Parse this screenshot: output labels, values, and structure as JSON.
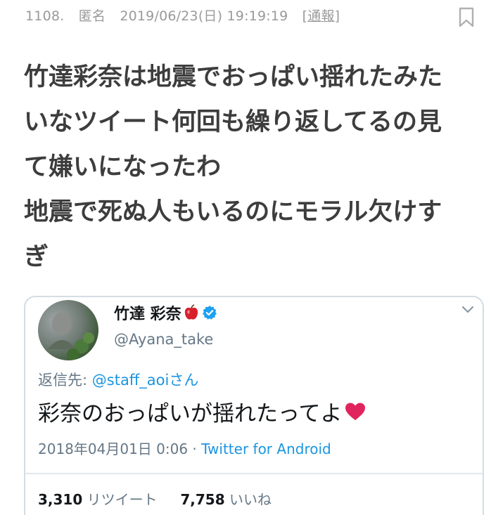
{
  "post": {
    "number": "1108.",
    "author": "匿名",
    "datetime": "2019/06/23(日) 19:19:19",
    "report_label": "[通報]",
    "comment_lines": [
      "竹達彩奈は地震でおっぱい揺れたみた",
      "いなツイート何回も繰り返してるの見",
      "て嫌いになったわ",
      "地震で死ぬ人もいるのにモラル欠けす",
      "ぎ"
    ]
  },
  "icons": {
    "bookmark": "bookmark-icon",
    "apple": "apple-icon",
    "verified": "verified-badge-icon",
    "chevron": "chevron-down-icon",
    "heart": "heart-icon"
  },
  "tweet": {
    "display_name": "竹達 彩奈",
    "handle": "@Ayana_take",
    "reply_prefix": "返信先: ",
    "reply_mention": "@staff_aoiさん",
    "text": "彩奈のおっぱいが揺れたってよ",
    "date": "2018年04月01日 0:06 · ",
    "source": "Twitter for Android",
    "retweet_count": "3,310",
    "retweet_label": "リツイート",
    "like_count": "7,758",
    "like_label": "いいね"
  },
  "colors": {
    "link": "#1b95e0",
    "heart": "#e0245e",
    "verified": "#1da1f2",
    "apple": "#d8202c"
  }
}
